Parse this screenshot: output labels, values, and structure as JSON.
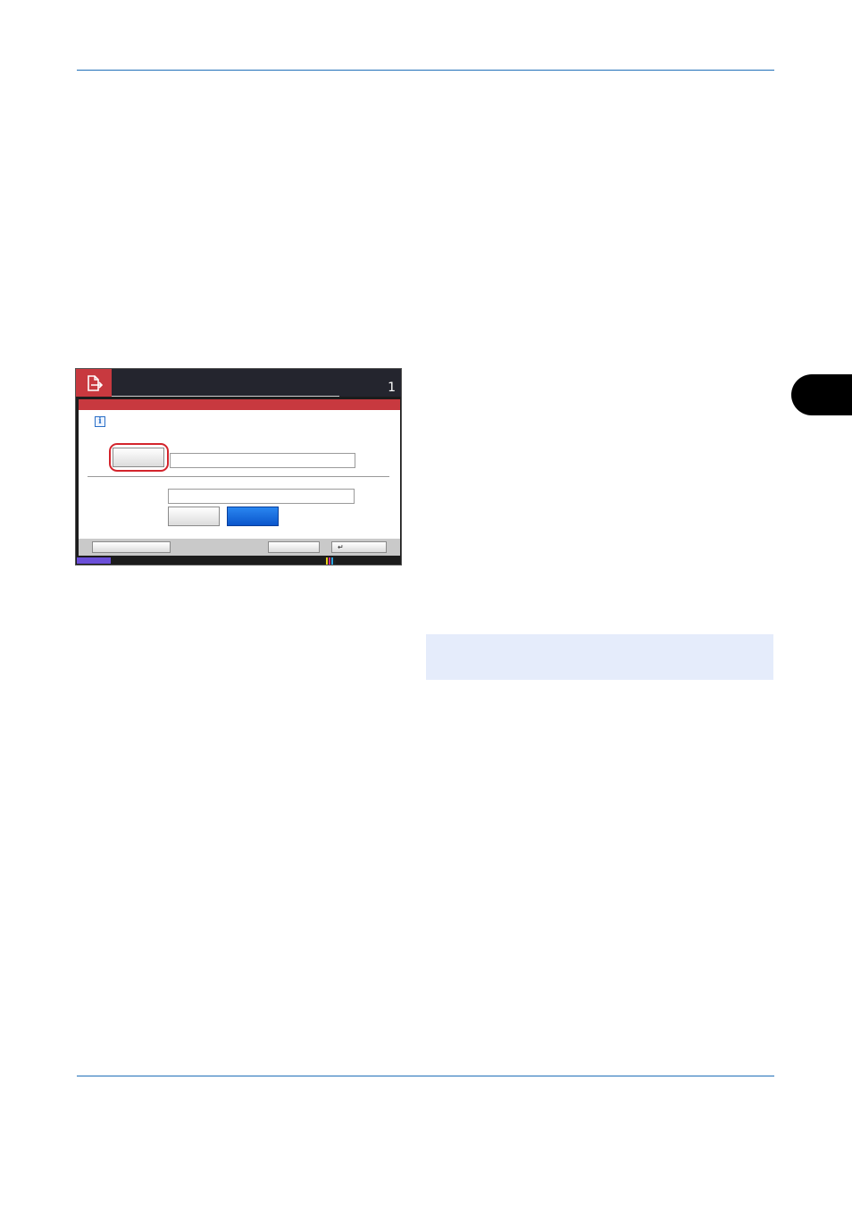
{
  "page": {
    "accent_color": "#1f6fb8",
    "note_background": "#e5ecfb"
  },
  "panel": {
    "mode_icon": "document-send-icon",
    "page_number": "1",
    "title_bar_color": "#c8393f",
    "info_icon": "info-icon",
    "info_glyph": "i",
    "action_button_color": "#0b56cc"
  },
  "toner_colors": [
    "#e8d21a",
    "#d02b8a",
    "#2fa6e0",
    "#222222"
  ]
}
